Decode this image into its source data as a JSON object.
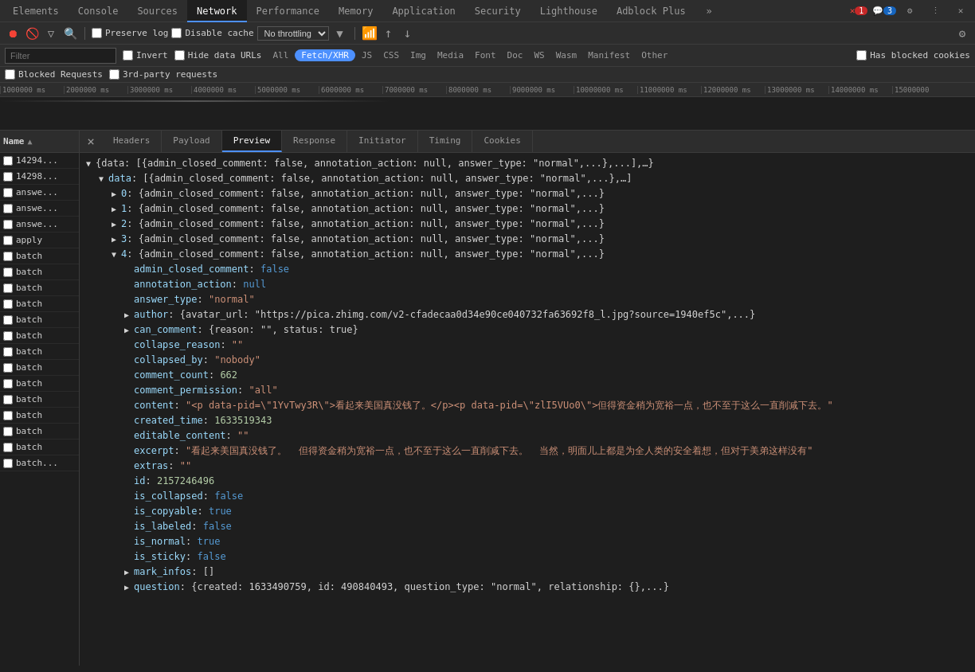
{
  "tabs": {
    "items": [
      {
        "label": "Elements",
        "active": false
      },
      {
        "label": "Console",
        "active": false
      },
      {
        "label": "Sources",
        "active": false
      },
      {
        "label": "Network",
        "active": true
      },
      {
        "label": "Performance",
        "active": false
      },
      {
        "label": "Memory",
        "active": false
      },
      {
        "label": "Application",
        "active": false
      },
      {
        "label": "Security",
        "active": false
      },
      {
        "label": "Lighthouse",
        "active": false
      },
      {
        "label": "Adblock Plus",
        "active": false
      }
    ],
    "more_label": "»",
    "error_badge": "1",
    "info_badge": "3"
  },
  "toolbar": {
    "record_tooltip": "Record network log",
    "clear_tooltip": "Clear",
    "filter_tooltip": "Filter",
    "search_tooltip": "Search",
    "preserve_log_label": "Preserve log",
    "disable_cache_label": "Disable cache",
    "throttle_value": "No throttling",
    "wifi_icon": "wifi",
    "upload_icon": "↑",
    "download_icon": "↓",
    "settings_icon": "⚙"
  },
  "filter_bar": {
    "placeholder": "Filter",
    "invert_label": "Invert",
    "hide_data_urls_label": "Hide data URLs",
    "types": [
      "All",
      "Fetch/XHR",
      "JS",
      "CSS",
      "Img",
      "Media",
      "Font",
      "Doc",
      "WS",
      "Wasm",
      "Manifest",
      "Other"
    ],
    "active_type": "Fetch/XHR",
    "has_blocked_cookies_label": "Has blocked cookies",
    "blocked_requests_label": "Blocked Requests",
    "third_party_label": "3rd-party requests"
  },
  "timeline": {
    "ticks": [
      "1000000 ms",
      "2000000 ms",
      "3000000 ms",
      "4000000 ms",
      "5000000 ms",
      "6000000 ms",
      "7000000 ms",
      "8000000 ms",
      "9000000 ms",
      "10000000 ms",
      "11000000 ms",
      "12000000 ms",
      "13000000 ms",
      "14000000 ms",
      "15000000"
    ]
  },
  "request_list": {
    "column_header": "Name",
    "sort_asc": true,
    "items": [
      {
        "name": "14294...",
        "selected": false
      },
      {
        "name": "14298...",
        "selected": false
      },
      {
        "name": "answe...",
        "selected": false
      },
      {
        "name": "answe...",
        "selected": false
      },
      {
        "name": "answe...",
        "selected": false
      },
      {
        "name": "apply",
        "selected": false
      },
      {
        "name": "batch",
        "selected": false
      },
      {
        "name": "batch",
        "selected": false
      },
      {
        "name": "batch",
        "selected": false
      },
      {
        "name": "batch",
        "selected": false
      },
      {
        "name": "batch",
        "selected": false
      },
      {
        "name": "batch",
        "selected": false
      },
      {
        "name": "batch",
        "selected": false
      },
      {
        "name": "batch",
        "selected": false
      },
      {
        "name": "batch",
        "selected": false
      },
      {
        "name": "batch",
        "selected": false
      },
      {
        "name": "batch",
        "selected": false
      },
      {
        "name": "batch",
        "selected": false
      },
      {
        "name": "batch",
        "selected": false
      },
      {
        "name": "batch...",
        "selected": false
      }
    ]
  },
  "detail_tabs": {
    "items": [
      {
        "label": "×",
        "is_close": true
      },
      {
        "label": "Headers",
        "active": false
      },
      {
        "label": "Payload",
        "active": false
      },
      {
        "label": "Preview",
        "active": true
      },
      {
        "label": "Response",
        "active": false
      },
      {
        "label": "Initiator",
        "active": false
      },
      {
        "label": "Timing",
        "active": false
      },
      {
        "label": "Cookies",
        "active": false
      }
    ]
  },
  "preview": {
    "lines": [
      {
        "indent": 0,
        "triangle": "open",
        "content_prefix": "",
        "key": "",
        "value": "{data: [{admin_closed_comment: false, annotation_action: null, answer_type: \"normal\",...},...],…}"
      },
      {
        "indent": 1,
        "triangle": "open",
        "key": "data",
        "value": "[{admin_closed_comment: false, annotation_action: null, answer_type: \"normal\",...},…]"
      },
      {
        "indent": 2,
        "triangle": "closed",
        "key": "0",
        "value": "{admin_closed_comment: false, annotation_action: null, answer_type: \"normal\",...}"
      },
      {
        "indent": 2,
        "triangle": "closed",
        "key": "1",
        "value": "{admin_closed_comment: false, annotation_action: null, answer_type: \"normal\",...}"
      },
      {
        "indent": 2,
        "triangle": "closed",
        "key": "2",
        "value": "{admin_closed_comment: false, annotation_action: null, answer_type: \"normal\",...}"
      },
      {
        "indent": 2,
        "triangle": "closed",
        "key": "3",
        "value": "{admin_closed_comment: false, annotation_action: null, answer_type: \"normal\",...}"
      },
      {
        "indent": 2,
        "triangle": "open",
        "key": "4",
        "value": "{admin_closed_comment: false, annotation_action: null, answer_type: \"normal\",...}"
      },
      {
        "indent": 3,
        "triangle": "none",
        "key": "admin_closed_comment",
        "value_type": "bool_false",
        "value": "false"
      },
      {
        "indent": 3,
        "triangle": "none",
        "key": "annotation_action",
        "value_type": "null",
        "value": "null"
      },
      {
        "indent": 3,
        "triangle": "none",
        "key": "answer_type",
        "value_type": "string",
        "value": "\"normal\""
      },
      {
        "indent": 3,
        "triangle": "closed",
        "key": "author",
        "value": "{avatar_url: \"https://pica.zhimg.com/v2-cfadecaa0d34e90ce040732fa63692f8_l.jpg?source=1940ef5c\",...}"
      },
      {
        "indent": 3,
        "triangle": "closed",
        "key": "can_comment",
        "value": "{reason: \"\", status: true}"
      },
      {
        "indent": 3,
        "triangle": "none",
        "key": "collapse_reason",
        "value_type": "string",
        "value": "\"\""
      },
      {
        "indent": 3,
        "triangle": "none",
        "key": "collapsed_by",
        "value_type": "string",
        "value": "\"nobody\""
      },
      {
        "indent": 3,
        "triangle": "none",
        "key": "comment_count",
        "value_type": "number",
        "value": "662"
      },
      {
        "indent": 3,
        "triangle": "none",
        "key": "comment_permission",
        "value_type": "string",
        "value": "\"all\""
      },
      {
        "indent": 3,
        "triangle": "none",
        "key": "content",
        "value_type": "string",
        "value": "\"<p data-pid=\\\"1YvTwy3R\\\">看起来美国真没钱了。</p><p data-pid=\\\"zlI5VUo0\\\">但得资金稍为宽裕一点，也不至于这么一直削减下去。\""
      },
      {
        "indent": 3,
        "triangle": "none",
        "key": "created_time",
        "value_type": "number",
        "value": "1633519343"
      },
      {
        "indent": 3,
        "triangle": "none",
        "key": "editable_content",
        "value_type": "string",
        "value": "\"\""
      },
      {
        "indent": 3,
        "triangle": "none",
        "key": "excerpt",
        "value_type": "string",
        "value": "\"看起来美国真没钱了。  但得资金稍为宽裕一点，也不至于这么一直削减下去。  当然，明面儿上都是为全人类的安全着想，但对于美弟这样没有\""
      },
      {
        "indent": 3,
        "triangle": "none",
        "key": "extras",
        "value_type": "string",
        "value": "\"\""
      },
      {
        "indent": 3,
        "triangle": "none",
        "key": "id",
        "value_type": "number",
        "value": "2157246496"
      },
      {
        "indent": 3,
        "triangle": "none",
        "key": "is_collapsed",
        "value_type": "bool_false",
        "value": "false"
      },
      {
        "indent": 3,
        "triangle": "none",
        "key": "is_copyable",
        "value_type": "bool_true",
        "value": "true"
      },
      {
        "indent": 3,
        "triangle": "none",
        "key": "is_labeled",
        "value_type": "bool_false",
        "value": "false"
      },
      {
        "indent": 3,
        "triangle": "none",
        "key": "is_normal",
        "value_type": "bool_true",
        "value": "true"
      },
      {
        "indent": 3,
        "triangle": "none",
        "key": "is_sticky",
        "value_type": "bool_false",
        "value": "false"
      },
      {
        "indent": 3,
        "triangle": "closed",
        "key": "mark_infos",
        "value": "[]"
      },
      {
        "indent": 3,
        "triangle": "closed",
        "key": "question",
        "value": "{created: 1633490759, id: 490840493, question_type: \"normal\", relationship: {},...}"
      }
    ]
  }
}
